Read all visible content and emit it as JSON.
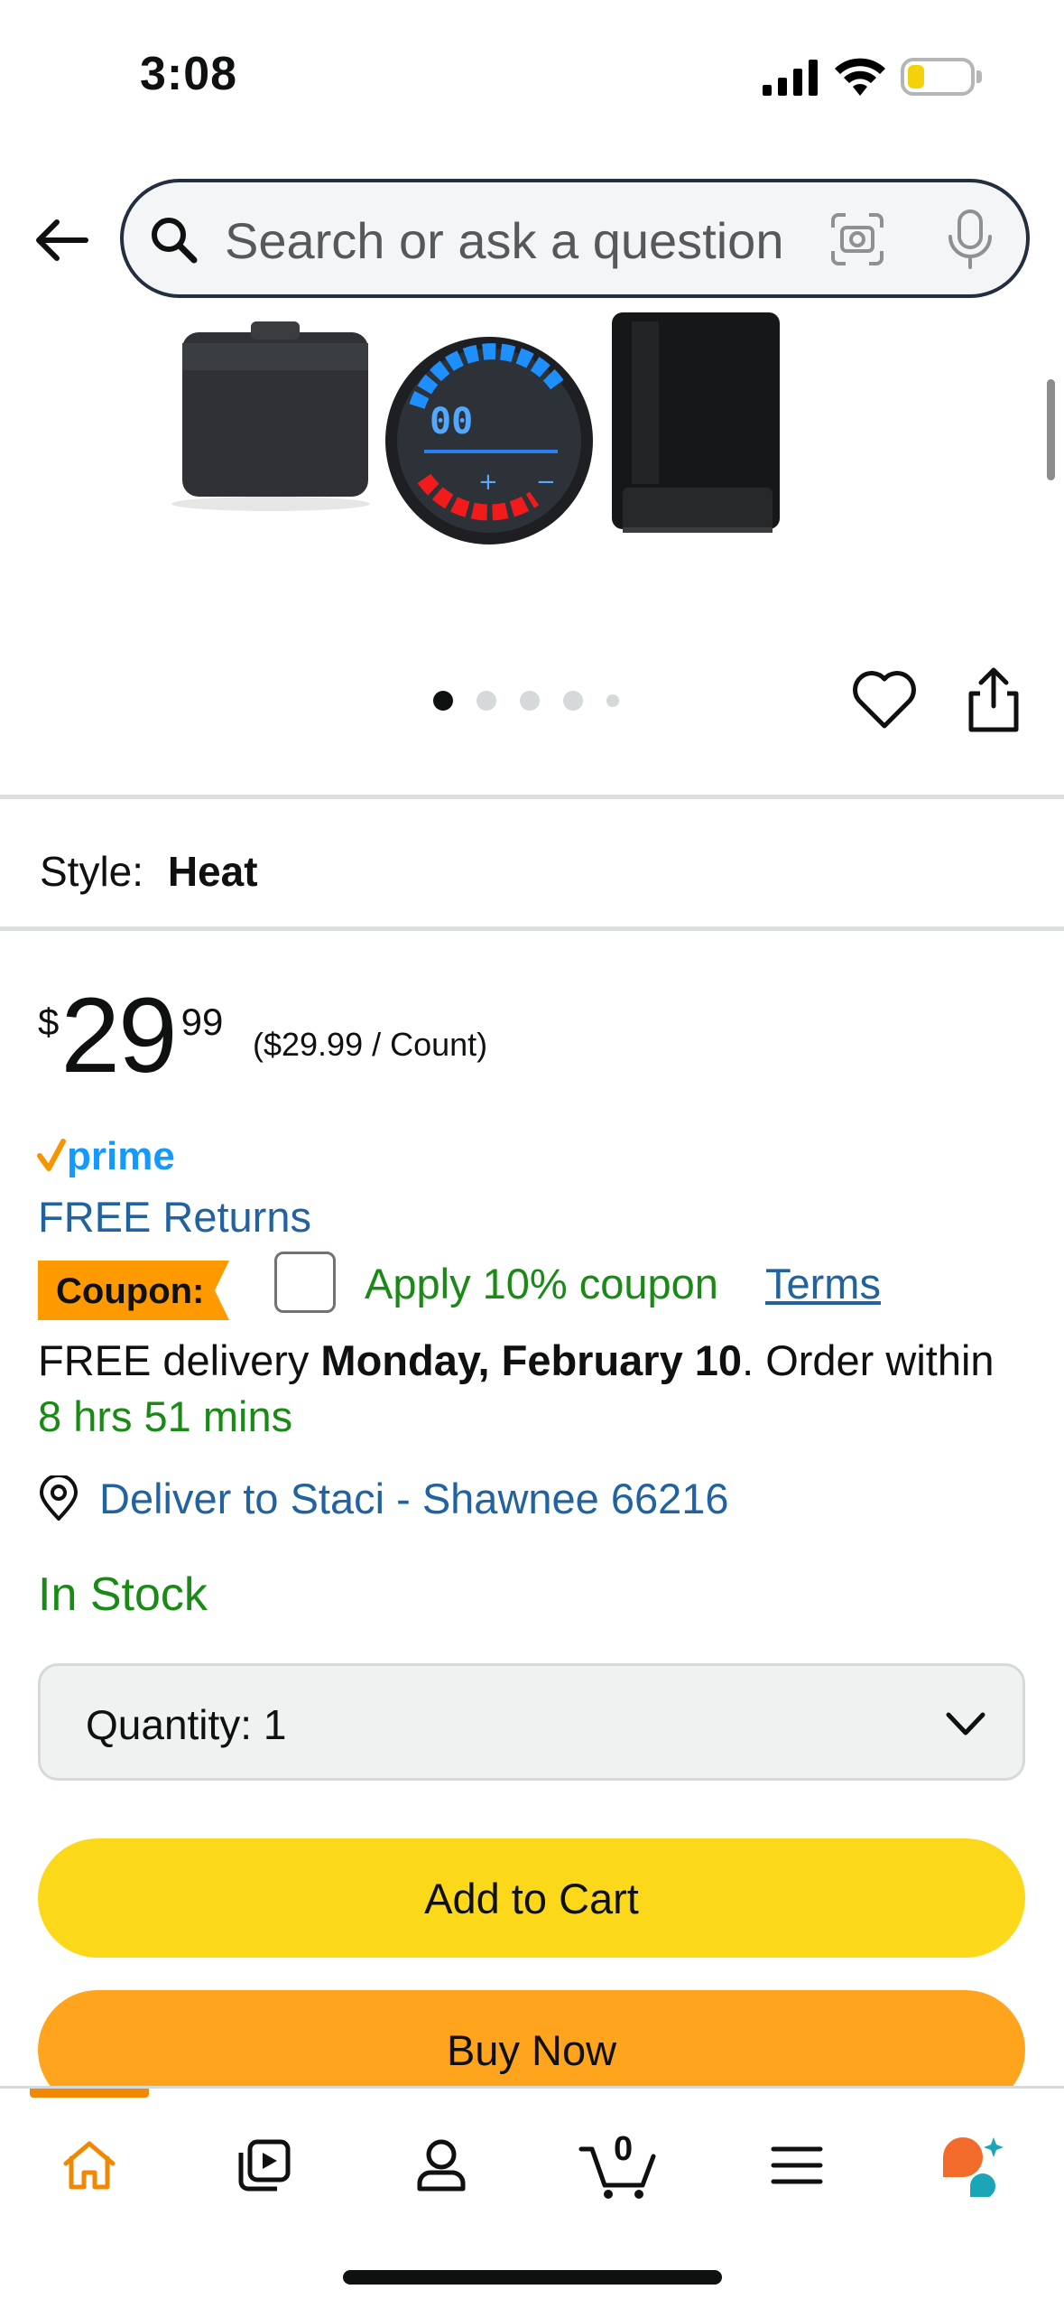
{
  "status_bar": {
    "time": "3:08"
  },
  "search": {
    "placeholder": "Search or ask a question"
  },
  "gallery": {
    "dot_count": 5,
    "active_dot": 1
  },
  "style": {
    "label": "Style:",
    "value": "Heat"
  },
  "price": {
    "currency": "$",
    "whole": "29",
    "fraction": "99",
    "unit_price": "($29.99 / Count)"
  },
  "prime": {
    "logo_text": "prime"
  },
  "free_returns": "FREE Returns",
  "coupon": {
    "badge": "Coupon:",
    "apply_text": "Apply 10% coupon",
    "terms": "Terms"
  },
  "delivery": {
    "prefix": "FREE delivery ",
    "date": "Monday, February 10",
    "suffix": ". Order within",
    "countdown": "8 hrs 51 mins"
  },
  "deliver_to": "Deliver to Staci - Shawnee 66216",
  "stock": "In Stock",
  "quantity": {
    "label": "Quantity:",
    "value": "1"
  },
  "buttons": {
    "add_to_cart": "Add to Cart",
    "buy_now": "Buy Now"
  },
  "cart": {
    "count": "0"
  },
  "colors": {
    "add_to_cart": "#fcd81b",
    "buy_now": "#ffa41c",
    "link": "#2162a1",
    "success": "#1a8a16",
    "active_nav": "#f08804"
  }
}
